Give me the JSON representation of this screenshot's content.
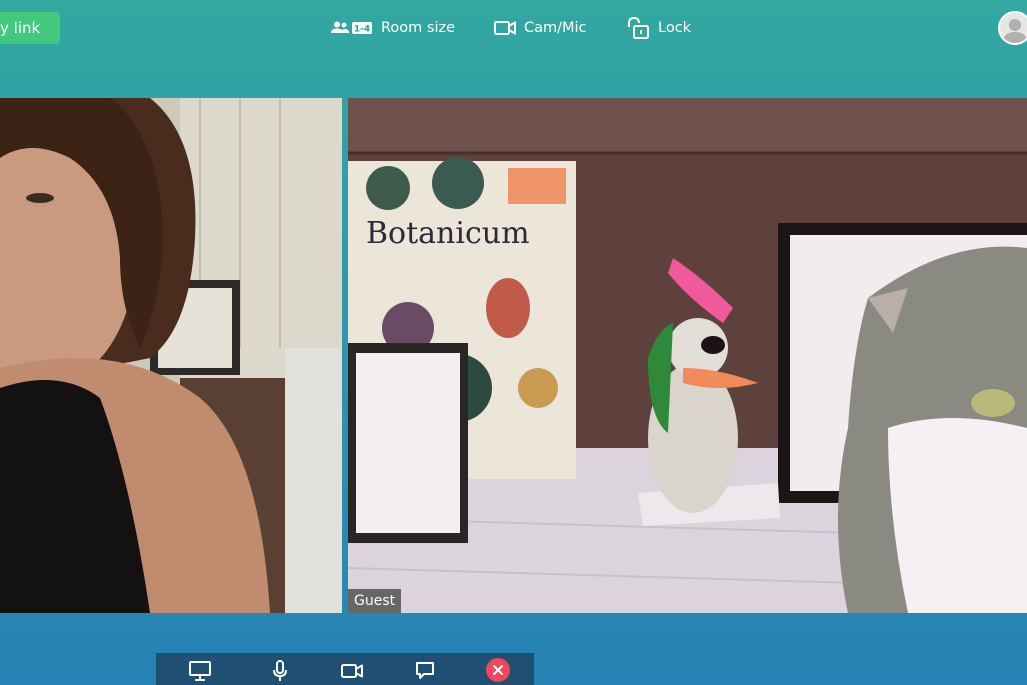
{
  "topbar": {
    "copy_link_label": "y link",
    "menu": [
      {
        "label": "Room size",
        "icon": "room-size-icon",
        "badge": "1-4"
      },
      {
        "label": "Cam/Mic",
        "icon": "camera-icon"
      },
      {
        "label": "Lock",
        "icon": "unlock-icon"
      }
    ]
  },
  "videos": [
    {
      "participant": "host",
      "name_tag": ""
    },
    {
      "participant": "guest",
      "name_tag": "Guest"
    }
  ],
  "controls": [
    {
      "name": "screen-share",
      "icon": "monitor-icon"
    },
    {
      "name": "microphone",
      "icon": "microphone-icon"
    },
    {
      "name": "camera",
      "icon": "video-camera-icon"
    },
    {
      "name": "chat",
      "icon": "chat-bubble-icon"
    },
    {
      "name": "leave",
      "icon": "close-icon"
    }
  ],
  "colors": {
    "accent_green": "#43c97e",
    "hangup_red": "#f0475d",
    "control_bar": "#1f4f72"
  }
}
